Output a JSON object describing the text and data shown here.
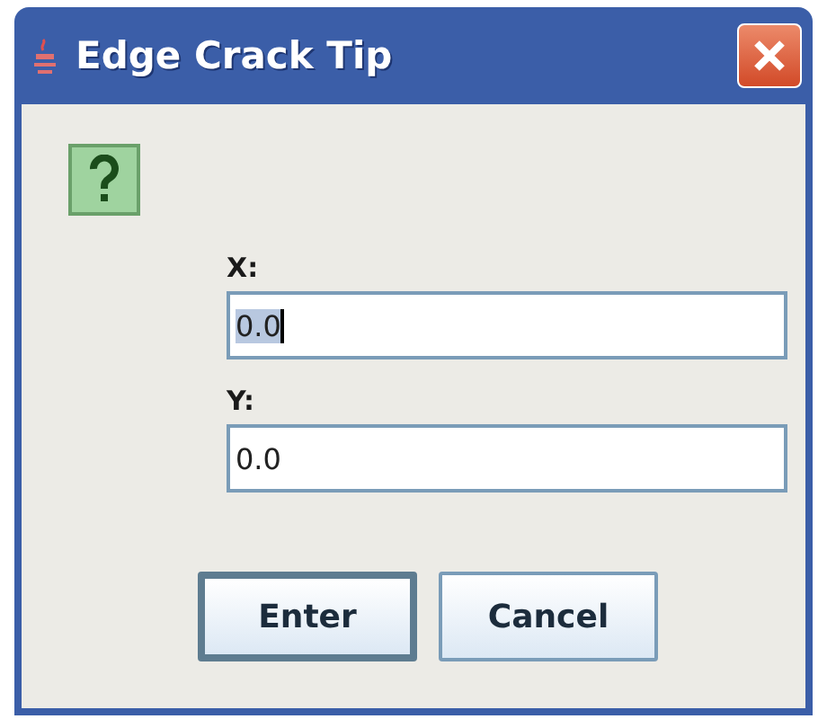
{
  "window": {
    "title": "Edge Crack Tip"
  },
  "fields": [
    {
      "label": "X:",
      "value": "0.0",
      "focused": true
    },
    {
      "label": "Y:",
      "value": "0.0",
      "focused": false
    }
  ],
  "buttons": [
    {
      "label": "Enter",
      "default": true
    },
    {
      "label": "Cancel",
      "default": false
    }
  ]
}
